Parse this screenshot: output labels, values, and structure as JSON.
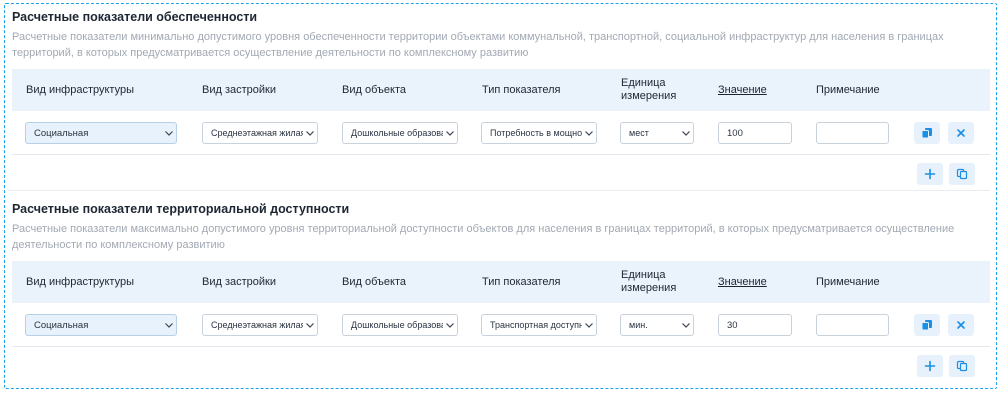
{
  "sections": [
    {
      "title": "Расчетные показатели обеспеченности",
      "description": "Расчетные показатели минимально допустимого уровня обеспеченности территории объектами коммунальной, транспортной, социальной инфраструктур для населения в границах территорий, в которых предусматривается осуществление деятельности по комплексному развитию",
      "headers": {
        "infra": "Вид инфраструктуры",
        "build": "Вид застройки",
        "object": "Вид объекта",
        "type": "Тип показателя",
        "unit_line1": "Единица",
        "unit_line2": "измерения",
        "value": "Значение",
        "note": "Примечание"
      },
      "row": {
        "infra": "Социальная",
        "build": "Среднеэтажная жилая",
        "object": "Дошкольные образоват",
        "type": "Потребность в мощнос",
        "unit": "мест",
        "value": "100",
        "note": ""
      }
    },
    {
      "title": "Расчетные показатели территориальной доступности",
      "description": "Расчетные показатели максимально допустимого уровня территориальной доступности объектов для населения в границах территорий, в которых предусматривается осуществление деятельности по комплексному развитию",
      "headers": {
        "infra": "Вид инфраструктуры",
        "build": "Вид застройки",
        "object": "Вид объекта",
        "type": "Тип показателя",
        "unit_line1": "Единица",
        "unit_line2": "измерения",
        "value": "Значение",
        "note": "Примечание"
      },
      "row": {
        "infra": "Социальная",
        "build": "Среднеэтажная жилая",
        "object": "Дошкольные образоват",
        "type": "Транспортная доступнс",
        "unit": "мин.",
        "value": "30",
        "note": ""
      }
    }
  ],
  "icons": {
    "copy_row": "copy-icon",
    "delete_row": "close-icon",
    "add_row": "plus-icon",
    "duplicate": "duplicate-icon"
  },
  "colors": {
    "accent": "#1a8fe3",
    "frame": "#1aa3e8",
    "header_bg": "#eaf3fc",
    "button_bg": "#e6f1fc"
  }
}
